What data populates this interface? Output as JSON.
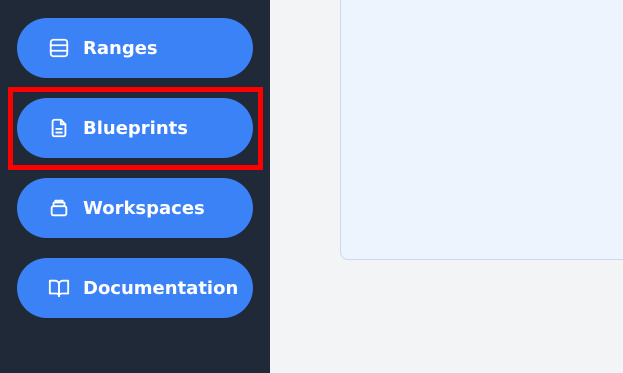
{
  "sidebar": {
    "items": [
      {
        "label": "Ranges",
        "icon": "database-icon"
      },
      {
        "label": "Blueprints",
        "icon": "file-text-icon"
      },
      {
        "label": "Workspaces",
        "icon": "archive-icon"
      },
      {
        "label": "Documentation",
        "icon": "book-open-icon"
      }
    ],
    "selected": "Blueprints"
  },
  "colors": {
    "sidebar_bg": "#1f2937",
    "button_bg": "#3b82f6",
    "highlight": "#ff0000",
    "page_bg": "#f3f4f6",
    "panel_bg": "#eef4fd"
  }
}
